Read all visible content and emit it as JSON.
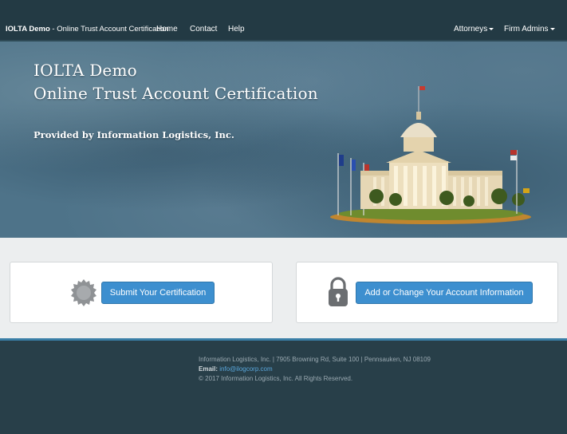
{
  "navbar": {
    "brand_name": "IOLTA Demo",
    "brand_suffix": " - Online Trust Account Certification",
    "links": [
      "Home",
      "Contact",
      "Help"
    ],
    "dropdowns": [
      "Attorneys",
      "Firm Admins"
    ]
  },
  "hero": {
    "title_line1": "IOLTA Demo",
    "title_line2": "Online Trust Account Certification",
    "provider": "Provided by Information Logistics, Inc.",
    "image": "capitol-building-with-flags"
  },
  "actions": {
    "certification_icon": "seal-badge-icon",
    "certification_button": "Submit Your Certification",
    "account_icon": "padlock-icon",
    "account_button": "Add or Change Your Account Information"
  },
  "footer": {
    "address": "Information Logistics, Inc. | 7905 Browning Rd, Suite 100 | Pennsauken, NJ 08109",
    "email_label": "Email:",
    "email": "info@ilogcorp.com",
    "copyright": "© 2017 Information Logistics, Inc. All Rights Reserved."
  },
  "colors": {
    "navbar": "#233a44",
    "hero": "#4e7389",
    "button": "#3d8fcf",
    "footer": "#283f49",
    "link": "#5aa7dc"
  }
}
